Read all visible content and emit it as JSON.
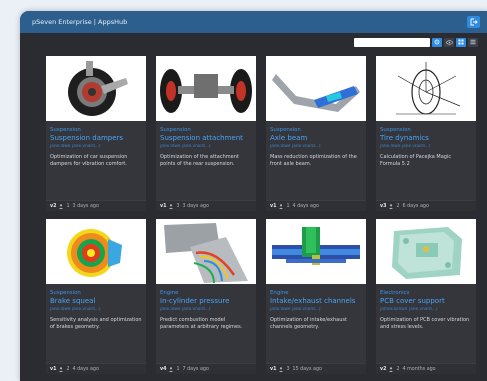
{
  "window": {
    "title": "pSeven Enterprise | AppsHub"
  },
  "toolbar": {
    "search_placeholder": ""
  },
  "icons": {
    "logout": "logout-icon",
    "settings": "gear-icon",
    "visibility": "eye-icon",
    "grid": "grid-view-icon",
    "list": "list-view-icon"
  },
  "colors": {
    "accent": "#2f8be0",
    "header": "#2c5f8e",
    "link": "#4ba3f5",
    "background": "#2a2c31"
  },
  "apps": [
    {
      "category": "Suspension",
      "name": "Suspension dampers",
      "authors": "jane.lowe jane.vnord...)",
      "description": "Optimization of car suspension dampers for vibration comfort.",
      "version": "v2",
      "count": "1",
      "age": "3 days ago"
    },
    {
      "category": "Suspension",
      "name": "Suspension attachment",
      "authors": "jane.lowe jane.vnord...)",
      "description": "Optimization of the attachment points of the rear suspension.",
      "version": "v1",
      "count": "3",
      "age": "3 days ago"
    },
    {
      "category": "Suspension",
      "name": "Axle beam",
      "authors": "jane.lowe jane.vnord...)",
      "description": "Mass reduction optimization of the front axle beam.",
      "version": "v1",
      "count": "1",
      "age": "4 days ago"
    },
    {
      "category": "Suspension",
      "name": "Tire dynamics",
      "authors": "jane.lowe jane.vnord...)",
      "description": "Calculation of Pacejka Magic Formula 5.2",
      "version": "v3",
      "count": "2",
      "age": "6 days ago"
    },
    {
      "category": "Suspension",
      "name": "Brake squeal",
      "authors": "jane.lowe jane.vnord...)",
      "description": "Sensitivity analysis and optimization of brakes geometry.",
      "version": "v1",
      "count": "2",
      "age": "4 days ago"
    },
    {
      "category": "Engine",
      "name": "In-cylinder pressure",
      "authors": "jane.lowe jane.vnord...)",
      "description": "Predict combustion model parameters at arbitrary regimes.",
      "version": "v4",
      "count": "1",
      "age": "7 days ago"
    },
    {
      "category": "Engine",
      "name": "Intake/exhaust channels",
      "authors": "jane.lowe jane.vnord...)",
      "description": "Optimization of intake/exhaust channels geometry.",
      "version": "v1",
      "count": "3",
      "age": "15 days ago"
    },
    {
      "category": "Electronics",
      "name": "PCB cover support",
      "authors": "james.brown jane.vnord...)",
      "description": "Optimization of PCB cover vibration and stress levels.",
      "version": "v2",
      "count": "2",
      "age": "4 months ago"
    }
  ]
}
